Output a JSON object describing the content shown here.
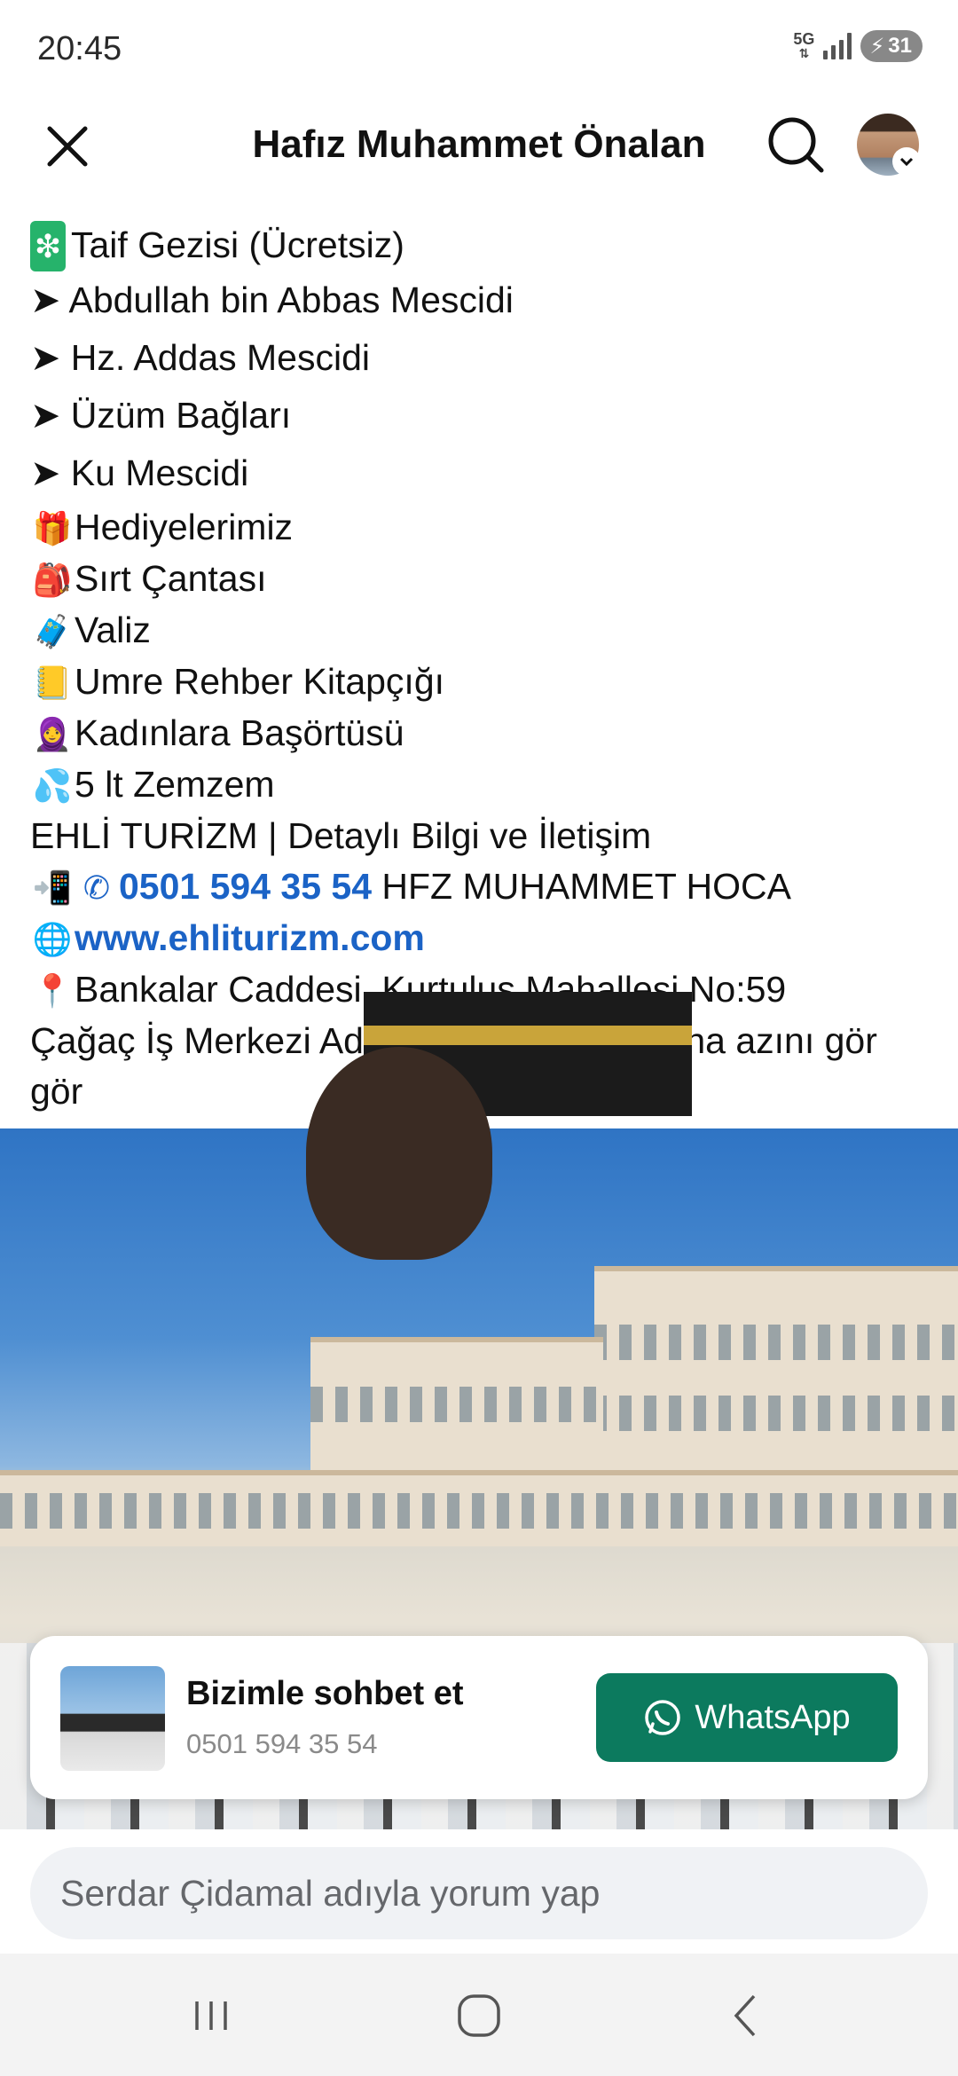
{
  "status": {
    "time": "20:45",
    "network": "5G",
    "battery": "31"
  },
  "header": {
    "title": "Hafız Muhammet Önalan"
  },
  "post": {
    "lines": [
      "Taif Gezisi (Ücretsiz)",
      "➤ Abdullah bin Abbas Mescidi",
      "➤ Hz. Addas Mescidi",
      "➤ Üzüm Bağları",
      "➤ Ku Mescidi",
      "Hediyelerimiz",
      "Sırt Çantası",
      "Valiz",
      "Umre Rehber Kitapçığı",
      "Kadınlara Başörtüsü",
      "5 lt Zemzem",
      "EHLİ TURİZM | Detaylı Bilgi ve İletişim",
      "0501 594 35 54",
      " HFZ MUHAMMET HOCA",
      "www.ehliturizm.com",
      "Bankalar Caddesi. Kurtuluş Mahallesi No:59",
      "Çağaç İş Merkezi  Adapazarı/Sakarya",
      " Daha azını gör"
    ]
  },
  "chat": {
    "title": "Bizimle sohbet et",
    "phone": "0501 594 35 54",
    "button": "WhatsApp"
  },
  "comment": {
    "placeholder": "Serdar Çidamal adıyla yorum yap"
  },
  "colors": {
    "link": "#1b63c6",
    "whatsapp": "#0c7a5e"
  }
}
